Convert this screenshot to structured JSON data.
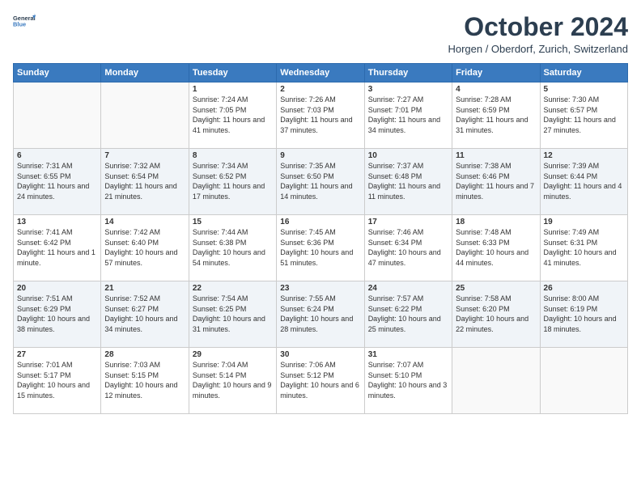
{
  "header": {
    "logo_general": "General",
    "logo_blue": "Blue",
    "month_title": "October 2024",
    "location": "Horgen / Oberdorf, Zurich, Switzerland"
  },
  "weekdays": [
    "Sunday",
    "Monday",
    "Tuesday",
    "Wednesday",
    "Thursday",
    "Friday",
    "Saturday"
  ],
  "weeks": [
    [
      {
        "day": "",
        "sunrise": "",
        "sunset": "",
        "daylight": ""
      },
      {
        "day": "",
        "sunrise": "",
        "sunset": "",
        "daylight": ""
      },
      {
        "day": "1",
        "sunrise": "Sunrise: 7:24 AM",
        "sunset": "Sunset: 7:05 PM",
        "daylight": "Daylight: 11 hours and 41 minutes."
      },
      {
        "day": "2",
        "sunrise": "Sunrise: 7:26 AM",
        "sunset": "Sunset: 7:03 PM",
        "daylight": "Daylight: 11 hours and 37 minutes."
      },
      {
        "day": "3",
        "sunrise": "Sunrise: 7:27 AM",
        "sunset": "Sunset: 7:01 PM",
        "daylight": "Daylight: 11 hours and 34 minutes."
      },
      {
        "day": "4",
        "sunrise": "Sunrise: 7:28 AM",
        "sunset": "Sunset: 6:59 PM",
        "daylight": "Daylight: 11 hours and 31 minutes."
      },
      {
        "day": "5",
        "sunrise": "Sunrise: 7:30 AM",
        "sunset": "Sunset: 6:57 PM",
        "daylight": "Daylight: 11 hours and 27 minutes."
      }
    ],
    [
      {
        "day": "6",
        "sunrise": "Sunrise: 7:31 AM",
        "sunset": "Sunset: 6:55 PM",
        "daylight": "Daylight: 11 hours and 24 minutes."
      },
      {
        "day": "7",
        "sunrise": "Sunrise: 7:32 AM",
        "sunset": "Sunset: 6:54 PM",
        "daylight": "Daylight: 11 hours and 21 minutes."
      },
      {
        "day": "8",
        "sunrise": "Sunrise: 7:34 AM",
        "sunset": "Sunset: 6:52 PM",
        "daylight": "Daylight: 11 hours and 17 minutes."
      },
      {
        "day": "9",
        "sunrise": "Sunrise: 7:35 AM",
        "sunset": "Sunset: 6:50 PM",
        "daylight": "Daylight: 11 hours and 14 minutes."
      },
      {
        "day": "10",
        "sunrise": "Sunrise: 7:37 AM",
        "sunset": "Sunset: 6:48 PM",
        "daylight": "Daylight: 11 hours and 11 minutes."
      },
      {
        "day": "11",
        "sunrise": "Sunrise: 7:38 AM",
        "sunset": "Sunset: 6:46 PM",
        "daylight": "Daylight: 11 hours and 7 minutes."
      },
      {
        "day": "12",
        "sunrise": "Sunrise: 7:39 AM",
        "sunset": "Sunset: 6:44 PM",
        "daylight": "Daylight: 11 hours and 4 minutes."
      }
    ],
    [
      {
        "day": "13",
        "sunrise": "Sunrise: 7:41 AM",
        "sunset": "Sunset: 6:42 PM",
        "daylight": "Daylight: 11 hours and 1 minute."
      },
      {
        "day": "14",
        "sunrise": "Sunrise: 7:42 AM",
        "sunset": "Sunset: 6:40 PM",
        "daylight": "Daylight: 10 hours and 57 minutes."
      },
      {
        "day": "15",
        "sunrise": "Sunrise: 7:44 AM",
        "sunset": "Sunset: 6:38 PM",
        "daylight": "Daylight: 10 hours and 54 minutes."
      },
      {
        "day": "16",
        "sunrise": "Sunrise: 7:45 AM",
        "sunset": "Sunset: 6:36 PM",
        "daylight": "Daylight: 10 hours and 51 minutes."
      },
      {
        "day": "17",
        "sunrise": "Sunrise: 7:46 AM",
        "sunset": "Sunset: 6:34 PM",
        "daylight": "Daylight: 10 hours and 47 minutes."
      },
      {
        "day": "18",
        "sunrise": "Sunrise: 7:48 AM",
        "sunset": "Sunset: 6:33 PM",
        "daylight": "Daylight: 10 hours and 44 minutes."
      },
      {
        "day": "19",
        "sunrise": "Sunrise: 7:49 AM",
        "sunset": "Sunset: 6:31 PM",
        "daylight": "Daylight: 10 hours and 41 minutes."
      }
    ],
    [
      {
        "day": "20",
        "sunrise": "Sunrise: 7:51 AM",
        "sunset": "Sunset: 6:29 PM",
        "daylight": "Daylight: 10 hours and 38 minutes."
      },
      {
        "day": "21",
        "sunrise": "Sunrise: 7:52 AM",
        "sunset": "Sunset: 6:27 PM",
        "daylight": "Daylight: 10 hours and 34 minutes."
      },
      {
        "day": "22",
        "sunrise": "Sunrise: 7:54 AM",
        "sunset": "Sunset: 6:25 PM",
        "daylight": "Daylight: 10 hours and 31 minutes."
      },
      {
        "day": "23",
        "sunrise": "Sunrise: 7:55 AM",
        "sunset": "Sunset: 6:24 PM",
        "daylight": "Daylight: 10 hours and 28 minutes."
      },
      {
        "day": "24",
        "sunrise": "Sunrise: 7:57 AM",
        "sunset": "Sunset: 6:22 PM",
        "daylight": "Daylight: 10 hours and 25 minutes."
      },
      {
        "day": "25",
        "sunrise": "Sunrise: 7:58 AM",
        "sunset": "Sunset: 6:20 PM",
        "daylight": "Daylight: 10 hours and 22 minutes."
      },
      {
        "day": "26",
        "sunrise": "Sunrise: 8:00 AM",
        "sunset": "Sunset: 6:19 PM",
        "daylight": "Daylight: 10 hours and 18 minutes."
      }
    ],
    [
      {
        "day": "27",
        "sunrise": "Sunrise: 7:01 AM",
        "sunset": "Sunset: 5:17 PM",
        "daylight": "Daylight: 10 hours and 15 minutes."
      },
      {
        "day": "28",
        "sunrise": "Sunrise: 7:03 AM",
        "sunset": "Sunset: 5:15 PM",
        "daylight": "Daylight: 10 hours and 12 minutes."
      },
      {
        "day": "29",
        "sunrise": "Sunrise: 7:04 AM",
        "sunset": "Sunset: 5:14 PM",
        "daylight": "Daylight: 10 hours and 9 minutes."
      },
      {
        "day": "30",
        "sunrise": "Sunrise: 7:06 AM",
        "sunset": "Sunset: 5:12 PM",
        "daylight": "Daylight: 10 hours and 6 minutes."
      },
      {
        "day": "31",
        "sunrise": "Sunrise: 7:07 AM",
        "sunset": "Sunset: 5:10 PM",
        "daylight": "Daylight: 10 hours and 3 minutes."
      },
      {
        "day": "",
        "sunrise": "",
        "sunset": "",
        "daylight": ""
      },
      {
        "day": "",
        "sunrise": "",
        "sunset": "",
        "daylight": ""
      }
    ]
  ]
}
